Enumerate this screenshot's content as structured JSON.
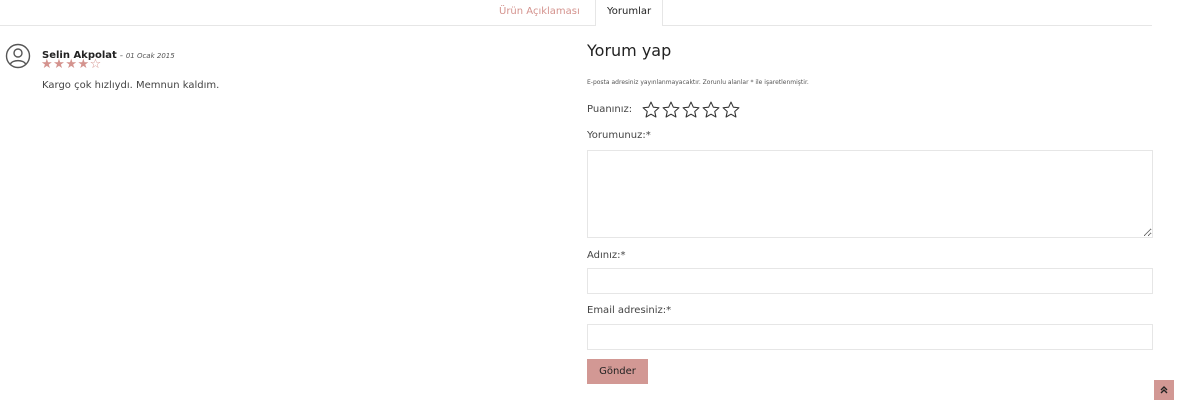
{
  "tabs": [
    {
      "label": "Ürün Açıklaması",
      "active": false
    },
    {
      "label": "Yorumlar",
      "active": true
    }
  ],
  "review": {
    "author": "Selin Akpolat",
    "separator": " - ",
    "date": "01 Ocak 2015",
    "rating": 4,
    "max_rating": 5,
    "text": "Kargo çok hızlıydı. Memnun kaldım."
  },
  "form": {
    "title": "Yorum yap",
    "note": "E-posta adresiniz yayınlanmayacaktır. Zorunlu alanlar * ile işaretlenmiştir.",
    "rating_label": "Puanınız:",
    "comment_label": "Yorumunuz:*",
    "name_label": "Adınız:*",
    "email_label": "Email adresiniz:*",
    "submit_label": "Gönder"
  },
  "icons": {
    "avatar": "user-circle-icon",
    "rating_star": "star-outline-icon",
    "scroll_top": "double-chevron-up-icon"
  },
  "colors": {
    "accent": "#d29894",
    "tab_inactive": "#d4938e"
  }
}
